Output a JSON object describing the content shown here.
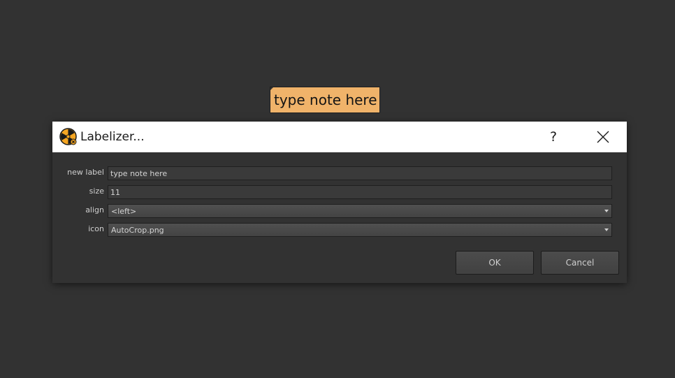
{
  "canvas": {
    "note_text": "type note here"
  },
  "dialog": {
    "title": "Labelizer...",
    "help_label": "?",
    "icon": "nuke-app-icon",
    "fields": {
      "new_label": {
        "label": "new label",
        "value": "type note here"
      },
      "size": {
        "label": "size",
        "value": "11"
      },
      "align": {
        "label": "align",
        "value": "<left>"
      },
      "icon": {
        "label": "icon",
        "value": "AutoCrop.png"
      }
    },
    "buttons": {
      "ok": "OK",
      "cancel": "Cancel"
    }
  },
  "colors": {
    "background": "#323232",
    "note": "#f0b36a",
    "titlebar": "#ffffff",
    "accent": "#f5a623"
  }
}
